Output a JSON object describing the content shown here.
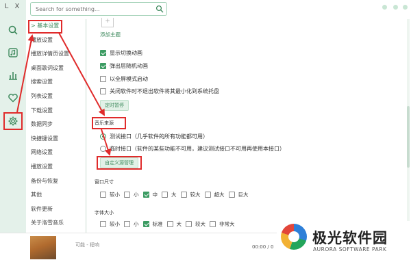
{
  "app": {
    "logo": "L X"
  },
  "search": {
    "placeholder": "Search for something..."
  },
  "sidebar": {
    "icons": [
      "search-icon",
      "music-library-icon",
      "chart-icon",
      "heart-icon",
      "gear-icon"
    ]
  },
  "nav": {
    "items": [
      {
        "label": "> 基本设置"
      },
      {
        "label": "播放设置"
      },
      {
        "label": "播放详情页设置"
      },
      {
        "label": "桌面歌词设置"
      },
      {
        "label": "搜索设置"
      },
      {
        "label": "列表设置"
      },
      {
        "label": "下载设置"
      },
      {
        "label": "数据同步"
      },
      {
        "label": "快捷键设置"
      },
      {
        "label": "网络设置"
      },
      {
        "label": "播放设置"
      },
      {
        "label": "备份与恢复"
      },
      {
        "label": "其他"
      },
      {
        "label": "软件更新"
      },
      {
        "label": "关于洛雪音乐"
      }
    ]
  },
  "main": {
    "add_theme": {
      "plus": "+",
      "label": "添加主题"
    },
    "options": [
      {
        "label": "显示切换动画",
        "checked": true
      },
      {
        "label": "弹出层随机动画",
        "checked": true
      },
      {
        "label": "以全屏模式启动",
        "checked": false
      },
      {
        "label": "关闭软件时不退出软件将其最小化到系统托盘",
        "checked": false
      }
    ],
    "timer_button": "定时暂停",
    "source_section": {
      "title": "音乐来源",
      "sources": [
        {
          "label": "测试接口（几乎软件的所有功能都可用）",
          "selected": true
        },
        {
          "label": "临时接口（软件的某些功能不可用，建议测试接口不可用再使用本接口）",
          "selected": false
        }
      ],
      "custom_source_button": "自定义源管理"
    },
    "window_size": {
      "title": "窗口尺寸",
      "options": [
        {
          "label": "较小",
          "checked": false
        },
        {
          "label": "小",
          "checked": false
        },
        {
          "label": "中",
          "checked": true
        },
        {
          "label": "大",
          "checked": false
        },
        {
          "label": "较大",
          "checked": false
        },
        {
          "label": "超大",
          "checked": false
        },
        {
          "label": "巨大",
          "checked": false
        }
      ]
    },
    "font_size": {
      "title": "字体大小",
      "options": [
        {
          "label": "较小",
          "checked": false
        },
        {
          "label": "小",
          "checked": false
        },
        {
          "label": "标准",
          "checked": true
        },
        {
          "label": "大",
          "checked": false
        },
        {
          "label": "较大",
          "checked": false
        },
        {
          "label": "非常大",
          "checked": false
        }
      ]
    }
  },
  "player": {
    "song": "可能 - 程响",
    "time": "00:00 / 0"
  },
  "watermark": {
    "cn": "极光软件园",
    "en": "AURORA SOFTWARE PARK"
  },
  "colors": {
    "accent": "#3c9c63",
    "annotation": "#e02b2b",
    "rail": "#e4f1ea"
  }
}
